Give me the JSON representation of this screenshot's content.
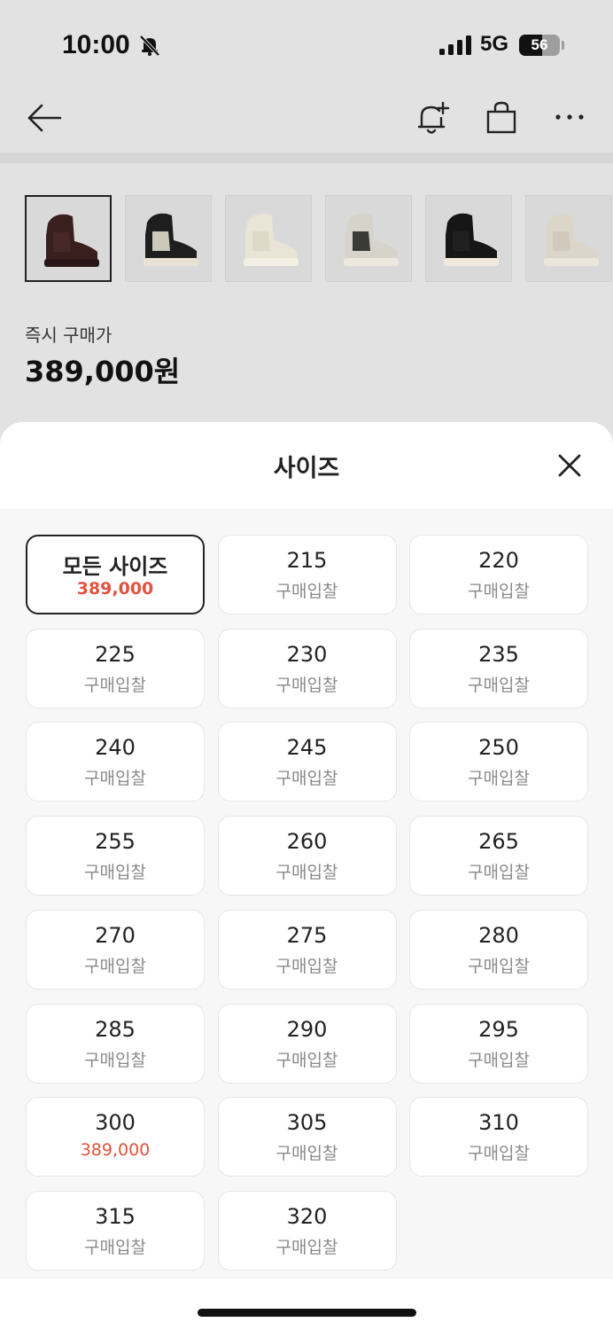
{
  "status_bar": {
    "time": "10:00",
    "network": "5G",
    "battery_level": "56"
  },
  "nav": {
    "back_icon": "arrow-left-icon",
    "alert_icon": "bell-plus-icon",
    "cart_icon": "shopping-bag-icon",
    "more_icon": "more-dots-icon"
  },
  "thumbnails": [
    {
      "color": "#3a1f1f",
      "sole": "#2a1616",
      "panel": "#4a2a2a"
    },
    {
      "color": "#1e1e1e",
      "sole": "#e8e2d4",
      "panel": "#ece6d8"
    },
    {
      "color": "#e9e4d6",
      "sole": "#f3efe4",
      "panel": "#dcd6c6"
    },
    {
      "color": "#d6d3cb",
      "sole": "#ece8dd",
      "panel": "#1e1e1e"
    },
    {
      "color": "#161616",
      "sole": "#efe9db",
      "panel": "#222"
    },
    {
      "color": "#dcd6ca",
      "sole": "#ebe6da",
      "panel": "#cfc8ba"
    }
  ],
  "product": {
    "price_label": "즉시 구매가",
    "price_value": "389,000원"
  },
  "sheet": {
    "title": "사이즈",
    "close_icon": "close-icon",
    "sizes": [
      {
        "size": "모든 사이즈",
        "sub": "389,000",
        "highlight": true,
        "selected": true
      },
      {
        "size": "215",
        "sub": "구매입찰",
        "highlight": false,
        "selected": false
      },
      {
        "size": "220",
        "sub": "구매입찰",
        "highlight": false,
        "selected": false
      },
      {
        "size": "225",
        "sub": "구매입찰",
        "highlight": false,
        "selected": false
      },
      {
        "size": "230",
        "sub": "구매입찰",
        "highlight": false,
        "selected": false
      },
      {
        "size": "235",
        "sub": "구매입찰",
        "highlight": false,
        "selected": false
      },
      {
        "size": "240",
        "sub": "구매입찰",
        "highlight": false,
        "selected": false
      },
      {
        "size": "245",
        "sub": "구매입찰",
        "highlight": false,
        "selected": false
      },
      {
        "size": "250",
        "sub": "구매입찰",
        "highlight": false,
        "selected": false
      },
      {
        "size": "255",
        "sub": "구매입찰",
        "highlight": false,
        "selected": false
      },
      {
        "size": "260",
        "sub": "구매입찰",
        "highlight": false,
        "selected": false
      },
      {
        "size": "265",
        "sub": "구매입찰",
        "highlight": false,
        "selected": false
      },
      {
        "size": "270",
        "sub": "구매입찰",
        "highlight": false,
        "selected": false
      },
      {
        "size": "275",
        "sub": "구매입찰",
        "highlight": false,
        "selected": false
      },
      {
        "size": "280",
        "sub": "구매입찰",
        "highlight": false,
        "selected": false
      },
      {
        "size": "285",
        "sub": "구매입찰",
        "highlight": false,
        "selected": false
      },
      {
        "size": "290",
        "sub": "구매입찰",
        "highlight": false,
        "selected": false
      },
      {
        "size": "295",
        "sub": "구매입찰",
        "highlight": false,
        "selected": false
      },
      {
        "size": "300",
        "sub": "389,000",
        "highlight": true,
        "selected": false
      },
      {
        "size": "305",
        "sub": "구매입찰",
        "highlight": false,
        "selected": false
      },
      {
        "size": "310",
        "sub": "구매입찰",
        "highlight": false,
        "selected": false
      },
      {
        "size": "315",
        "sub": "구매입찰",
        "highlight": false,
        "selected": false
      },
      {
        "size": "320",
        "sub": "구매입찰",
        "highlight": false,
        "selected": false
      }
    ]
  },
  "colors": {
    "accent_red": "#e0533f",
    "background": "#e2e2e2"
  }
}
